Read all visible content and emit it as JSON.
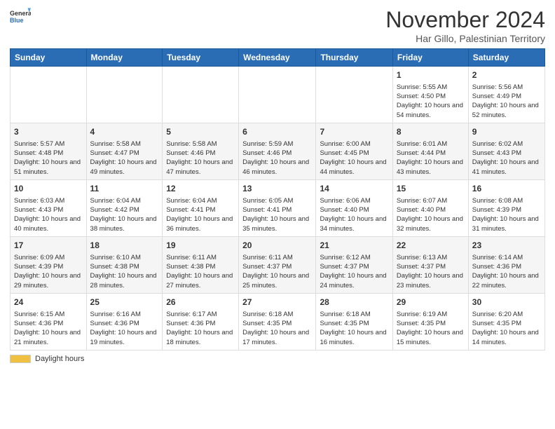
{
  "header": {
    "logo_general": "General",
    "logo_blue": "Blue",
    "title": "November 2024",
    "location": "Har Gillo, Palestinian Territory"
  },
  "columns": [
    "Sunday",
    "Monday",
    "Tuesday",
    "Wednesday",
    "Thursday",
    "Friday",
    "Saturday"
  ],
  "weeks": [
    [
      {
        "day": "",
        "info": ""
      },
      {
        "day": "",
        "info": ""
      },
      {
        "day": "",
        "info": ""
      },
      {
        "day": "",
        "info": ""
      },
      {
        "day": "",
        "info": ""
      },
      {
        "day": "1",
        "info": "Sunrise: 5:55 AM\nSunset: 4:50 PM\nDaylight: 10 hours and 54 minutes."
      },
      {
        "day": "2",
        "info": "Sunrise: 5:56 AM\nSunset: 4:49 PM\nDaylight: 10 hours and 52 minutes."
      }
    ],
    [
      {
        "day": "3",
        "info": "Sunrise: 5:57 AM\nSunset: 4:48 PM\nDaylight: 10 hours and 51 minutes."
      },
      {
        "day": "4",
        "info": "Sunrise: 5:58 AM\nSunset: 4:47 PM\nDaylight: 10 hours and 49 minutes."
      },
      {
        "day": "5",
        "info": "Sunrise: 5:58 AM\nSunset: 4:46 PM\nDaylight: 10 hours and 47 minutes."
      },
      {
        "day": "6",
        "info": "Sunrise: 5:59 AM\nSunset: 4:46 PM\nDaylight: 10 hours and 46 minutes."
      },
      {
        "day": "7",
        "info": "Sunrise: 6:00 AM\nSunset: 4:45 PM\nDaylight: 10 hours and 44 minutes."
      },
      {
        "day": "8",
        "info": "Sunrise: 6:01 AM\nSunset: 4:44 PM\nDaylight: 10 hours and 43 minutes."
      },
      {
        "day": "9",
        "info": "Sunrise: 6:02 AM\nSunset: 4:43 PM\nDaylight: 10 hours and 41 minutes."
      }
    ],
    [
      {
        "day": "10",
        "info": "Sunrise: 6:03 AM\nSunset: 4:43 PM\nDaylight: 10 hours and 40 minutes."
      },
      {
        "day": "11",
        "info": "Sunrise: 6:04 AM\nSunset: 4:42 PM\nDaylight: 10 hours and 38 minutes."
      },
      {
        "day": "12",
        "info": "Sunrise: 6:04 AM\nSunset: 4:41 PM\nDaylight: 10 hours and 36 minutes."
      },
      {
        "day": "13",
        "info": "Sunrise: 6:05 AM\nSunset: 4:41 PM\nDaylight: 10 hours and 35 minutes."
      },
      {
        "day": "14",
        "info": "Sunrise: 6:06 AM\nSunset: 4:40 PM\nDaylight: 10 hours and 34 minutes."
      },
      {
        "day": "15",
        "info": "Sunrise: 6:07 AM\nSunset: 4:40 PM\nDaylight: 10 hours and 32 minutes."
      },
      {
        "day": "16",
        "info": "Sunrise: 6:08 AM\nSunset: 4:39 PM\nDaylight: 10 hours and 31 minutes."
      }
    ],
    [
      {
        "day": "17",
        "info": "Sunrise: 6:09 AM\nSunset: 4:39 PM\nDaylight: 10 hours and 29 minutes."
      },
      {
        "day": "18",
        "info": "Sunrise: 6:10 AM\nSunset: 4:38 PM\nDaylight: 10 hours and 28 minutes."
      },
      {
        "day": "19",
        "info": "Sunrise: 6:11 AM\nSunset: 4:38 PM\nDaylight: 10 hours and 27 minutes."
      },
      {
        "day": "20",
        "info": "Sunrise: 6:11 AM\nSunset: 4:37 PM\nDaylight: 10 hours and 25 minutes."
      },
      {
        "day": "21",
        "info": "Sunrise: 6:12 AM\nSunset: 4:37 PM\nDaylight: 10 hours and 24 minutes."
      },
      {
        "day": "22",
        "info": "Sunrise: 6:13 AM\nSunset: 4:37 PM\nDaylight: 10 hours and 23 minutes."
      },
      {
        "day": "23",
        "info": "Sunrise: 6:14 AM\nSunset: 4:36 PM\nDaylight: 10 hours and 22 minutes."
      }
    ],
    [
      {
        "day": "24",
        "info": "Sunrise: 6:15 AM\nSunset: 4:36 PM\nDaylight: 10 hours and 21 minutes."
      },
      {
        "day": "25",
        "info": "Sunrise: 6:16 AM\nSunset: 4:36 PM\nDaylight: 10 hours and 19 minutes."
      },
      {
        "day": "26",
        "info": "Sunrise: 6:17 AM\nSunset: 4:36 PM\nDaylight: 10 hours and 18 minutes."
      },
      {
        "day": "27",
        "info": "Sunrise: 6:18 AM\nSunset: 4:35 PM\nDaylight: 10 hours and 17 minutes."
      },
      {
        "day": "28",
        "info": "Sunrise: 6:18 AM\nSunset: 4:35 PM\nDaylight: 10 hours and 16 minutes."
      },
      {
        "day": "29",
        "info": "Sunrise: 6:19 AM\nSunset: 4:35 PM\nDaylight: 10 hours and 15 minutes."
      },
      {
        "day": "30",
        "info": "Sunrise: 6:20 AM\nSunset: 4:35 PM\nDaylight: 10 hours and 14 minutes."
      }
    ]
  ],
  "legend": {
    "daylight_hours": "Daylight hours"
  }
}
